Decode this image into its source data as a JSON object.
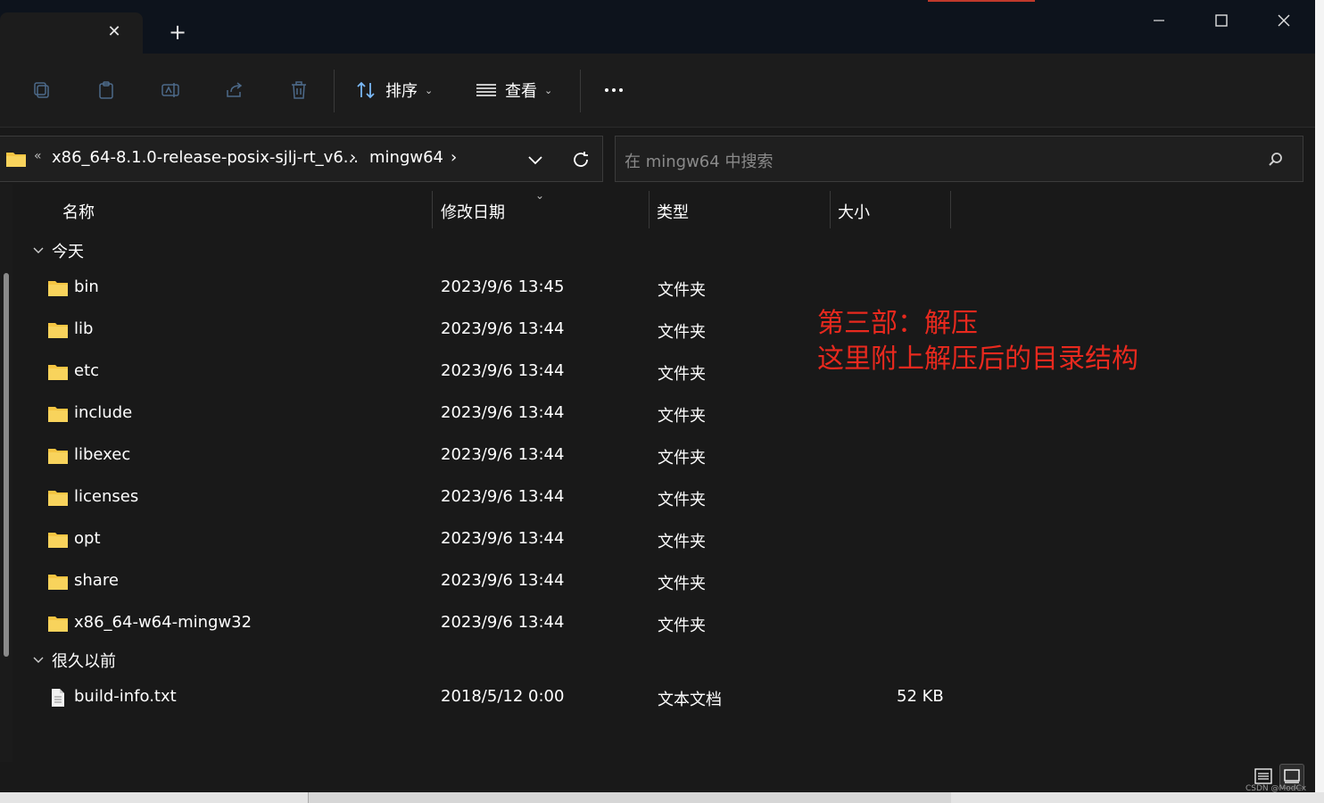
{
  "titlebar": {
    "tab_close_glyph": "✕",
    "new_tab_glyph": "+",
    "accent_color": "#c0392b"
  },
  "toolbar": {
    "sort_label": "排序",
    "view_label": "查看",
    "icons": [
      "copy-icon",
      "paste-icon",
      "rename-icon",
      "share-icon",
      "delete-icon",
      "sort-icon",
      "view-icon",
      "more-icon"
    ]
  },
  "address": {
    "crumb_overflow": "«",
    "crumb1": "x86_64-8.1.0-release-posix-sjlj-rt_v6...",
    "separator": "›",
    "crumb2": "mingw64"
  },
  "search": {
    "placeholder": "在 mingw64 中搜索"
  },
  "columns": {
    "name": "名称",
    "date": "修改日期",
    "type": "类型",
    "size": "大小"
  },
  "groups": {
    "today": "今天",
    "long_ago": "很久以前"
  },
  "files_today": [
    {
      "name": "bin",
      "date": "2023/9/6 13:45",
      "type": "文件夹",
      "size": ""
    },
    {
      "name": "lib",
      "date": "2023/9/6 13:44",
      "type": "文件夹",
      "size": ""
    },
    {
      "name": "etc",
      "date": "2023/9/6 13:44",
      "type": "文件夹",
      "size": ""
    },
    {
      "name": "include",
      "date": "2023/9/6 13:44",
      "type": "文件夹",
      "size": ""
    },
    {
      "name": "libexec",
      "date": "2023/9/6 13:44",
      "type": "文件夹",
      "size": ""
    },
    {
      "name": "licenses",
      "date": "2023/9/6 13:44",
      "type": "文件夹",
      "size": ""
    },
    {
      "name": "opt",
      "date": "2023/9/6 13:44",
      "type": "文件夹",
      "size": ""
    },
    {
      "name": "share",
      "date": "2023/9/6 13:44",
      "type": "文件夹",
      "size": ""
    },
    {
      "name": "x86_64-w64-mingw32",
      "date": "2023/9/6 13:44",
      "type": "文件夹",
      "size": ""
    }
  ],
  "files_old": [
    {
      "name": "build-info.txt",
      "date": "2018/5/12 0:00",
      "type": "文本文档",
      "size": "52 KB"
    }
  ],
  "annotation": {
    "line1": "第三部：解压",
    "line2": "这里附上解压后的目录结构",
    "color": "#e8291e"
  },
  "watermark": "CSDN @ModCx",
  "colors": {
    "folder": "#f5c542",
    "window_bg": "#191919",
    "titlebar_bg": "#0d131c"
  }
}
